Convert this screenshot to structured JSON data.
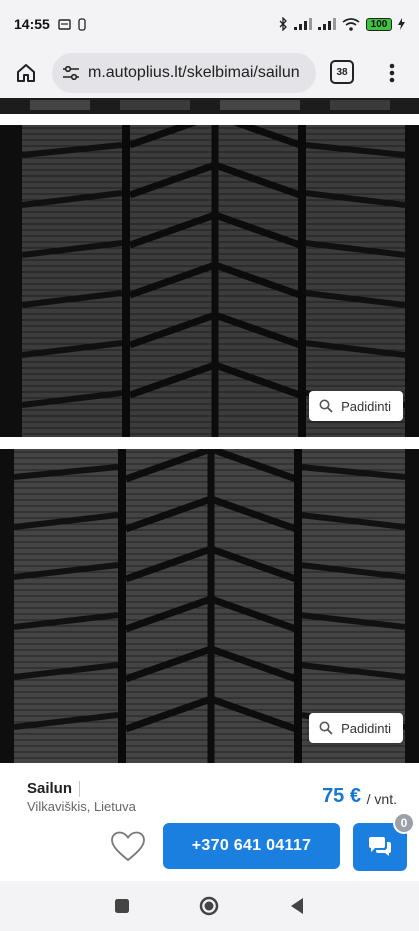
{
  "status_bar": {
    "time": "14:55",
    "battery": "100",
    "left_icons": [
      "sim-card-icon",
      "settings-notification-icon"
    ],
    "right_icons": [
      "bluetooth-icon",
      "signal-icon",
      "signal-icon",
      "wifi-icon",
      "battery-icon",
      "charging-icon"
    ]
  },
  "browser": {
    "url": "m.autoplius.lt/skelbimai/sailun",
    "tab_count": "38"
  },
  "gallery": {
    "zoom_label": "Padidinti",
    "photos": [
      {
        "label": "tire-photo-1"
      },
      {
        "label": "tire-photo-2"
      }
    ]
  },
  "listing": {
    "brand": "Sailun",
    "location": "Vilkaviškis, Lietuva",
    "price": "75 €",
    "price_unit": "/ vnt.",
    "phone": "+370 641 04117",
    "chat_badge": "0"
  },
  "colors": {
    "accent": "#1b7fe0",
    "price": "#1677d2",
    "chrome": "#f3f3f6"
  }
}
